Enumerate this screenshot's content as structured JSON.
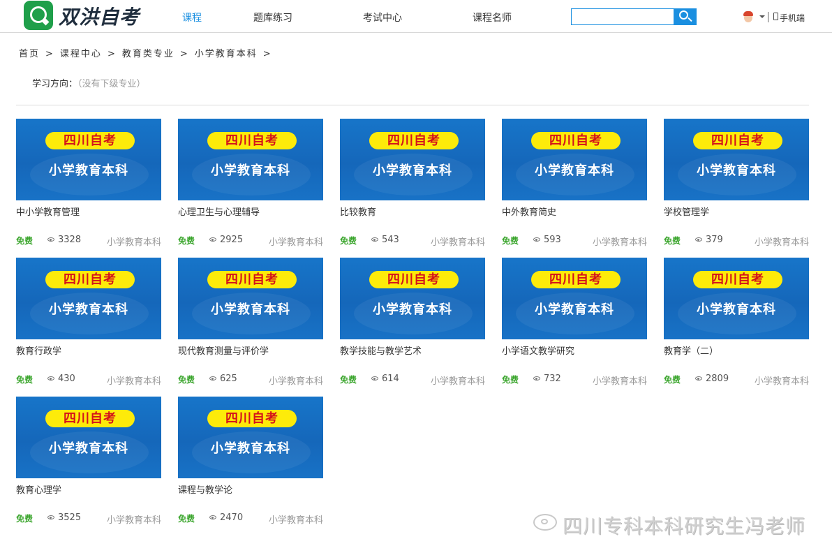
{
  "header": {
    "site_name": "双洪自考",
    "nav": [
      {
        "label": "课程",
        "active": true
      },
      {
        "label": "题库练习",
        "active": false
      },
      {
        "label": "考试中心",
        "active": false
      },
      {
        "label": "课程名师",
        "active": false
      }
    ],
    "search": {
      "value": "",
      "placeholder": ""
    },
    "mobile_label": "手机端"
  },
  "breadcrumb": [
    "首页",
    "课程中心",
    "教育类专业",
    "小学教育本科"
  ],
  "breadcrumb_separator": ">",
  "direction": {
    "label": "学习方向：",
    "value": "（没有下级专业）"
  },
  "thumbnail": {
    "badge": "四川自考",
    "subtitle": "小学教育本科"
  },
  "courses": [
    {
      "title": "中小学教育管理",
      "price": "免费",
      "views": "3328",
      "category": "小学教育本科"
    },
    {
      "title": "心理卫生与心理辅导",
      "price": "免费",
      "views": "2925",
      "category": "小学教育本科"
    },
    {
      "title": "比较教育",
      "price": "免费",
      "views": "543",
      "category": "小学教育本科"
    },
    {
      "title": "中外教育简史",
      "price": "免费",
      "views": "593",
      "category": "小学教育本科"
    },
    {
      "title": "学校管理学",
      "price": "免费",
      "views": "379",
      "category": "小学教育本科"
    },
    {
      "title": "教育行政学",
      "price": "免费",
      "views": "430",
      "category": "小学教育本科"
    },
    {
      "title": "现代教育测量与评价学",
      "price": "免费",
      "views": "625",
      "category": "小学教育本科"
    },
    {
      "title": "教学技能与教学艺术",
      "price": "免费",
      "views": "614",
      "category": "小学教育本科"
    },
    {
      "title": "小学语文教学研究",
      "price": "免费",
      "views": "732",
      "category": "小学教育本科"
    },
    {
      "title": "教育学（二）",
      "price": "免费",
      "views": "2809",
      "category": "小学教育本科"
    },
    {
      "title": "教育心理学",
      "price": "免费",
      "views": "3525",
      "category": "小学教育本科"
    },
    {
      "title": "课程与教学论",
      "price": "免费",
      "views": "2470",
      "category": "小学教育本科"
    }
  ],
  "watermark": "四川专科本科研究生冯老师",
  "colors": {
    "accent": "#1a8fe0",
    "free": "#3aa52c",
    "thumb_bg": "#1567ba",
    "badge_bg": "#fdeb0a",
    "badge_text": "#d4121a"
  }
}
